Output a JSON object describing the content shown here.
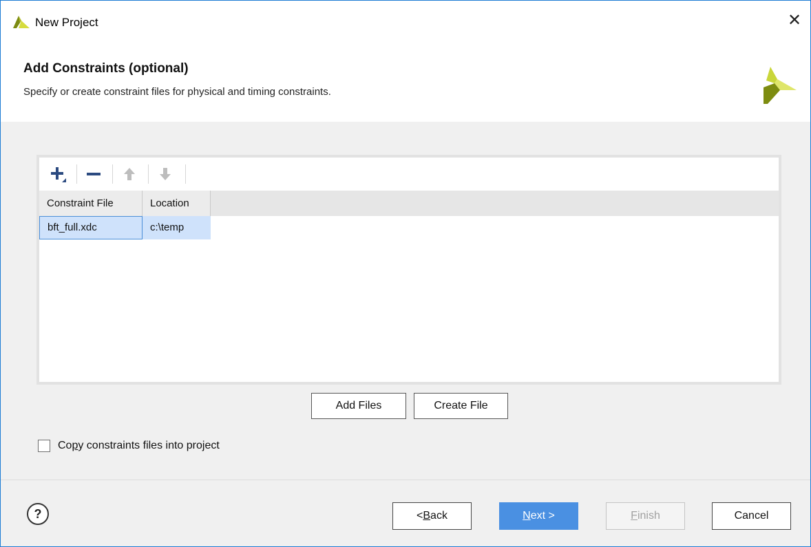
{
  "window": {
    "title": "New Project",
    "close_glyph": "✕"
  },
  "header": {
    "heading": "Add Constraints (optional)",
    "description": "Specify or create constraint files for physical and timing constraints."
  },
  "toolbar": {
    "icons": [
      "add-icon",
      "remove-icon",
      "move-up-icon",
      "move-down-icon"
    ]
  },
  "table": {
    "columns": [
      "Constraint File",
      "Location"
    ],
    "rows": [
      {
        "file": "bft_full.xdc",
        "location": "c:\\temp"
      }
    ]
  },
  "actions": {
    "add_files": "Add Files",
    "create_file": "Create File"
  },
  "checkbox": {
    "label_pre": "Co",
    "label_mnemonic": "p",
    "label_post": "y constraints files into project",
    "checked": false
  },
  "footer": {
    "help_glyph": "?",
    "back": {
      "prefix": "< ",
      "mnemonic": "B",
      "rest": "ack"
    },
    "next": {
      "mnemonic": "N",
      "rest": "ext >"
    },
    "finish": {
      "mnemonic": "F",
      "rest": "inish"
    },
    "cancel": "Cancel"
  },
  "colors": {
    "accent": "#4a90e2",
    "selection": "#cfe2fb",
    "logo_green": "#8a9a1b",
    "logo_yellow": "#d8e04a"
  }
}
